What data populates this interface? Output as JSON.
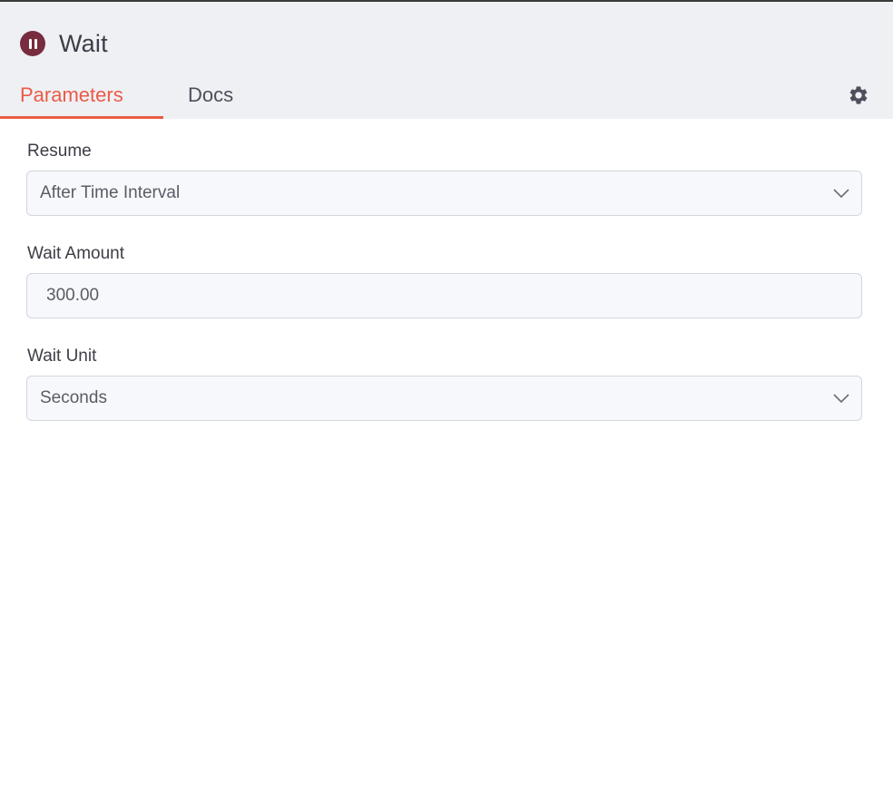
{
  "node": {
    "title": "Wait",
    "icon": "pause-circle-icon",
    "icon_color": "#772d3f"
  },
  "tabs": [
    {
      "label": "Parameters",
      "active": true
    },
    {
      "label": "Docs",
      "active": false
    }
  ],
  "accent_color": "#ea5b47",
  "settings_icon": "gear-icon",
  "fields": {
    "resume": {
      "label": "Resume",
      "value": "After Time Interval"
    },
    "wait_amount": {
      "label": "Wait Amount",
      "value": "300.00"
    },
    "wait_unit": {
      "label": "Wait Unit",
      "value": "Seconds"
    }
  }
}
